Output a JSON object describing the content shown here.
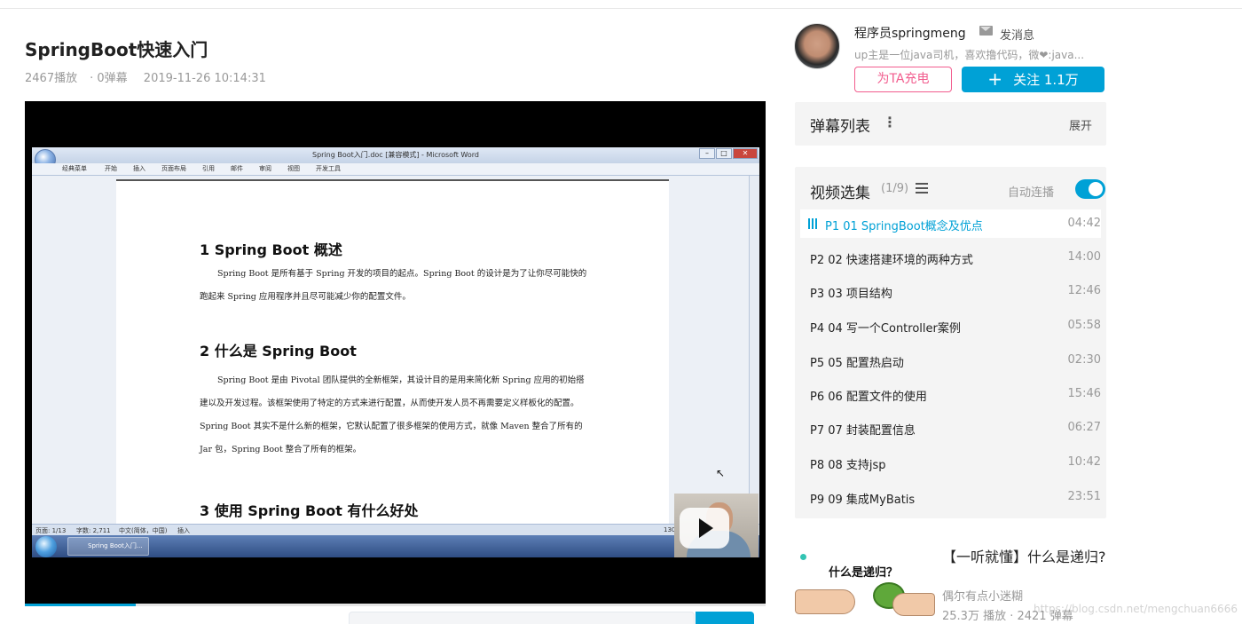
{
  "video": {
    "title": "SpringBoot快速入门",
    "plays": "2467播放",
    "danmaku_count": "0弹幕",
    "date": "2019-11-26 10:14:31",
    "progress_fraction": 0.15
  },
  "word": {
    "window_title": "Spring Boot入门.doc [兼容模式] - Microsoft Word",
    "ribbon_tabs": [
      "经典菜单",
      "开始",
      "插入",
      "页面布局",
      "引用",
      "邮件",
      "审阅",
      "视图",
      "开发工具"
    ],
    "headings": [
      "1 Spring Boot 概述",
      "2 什么是 Spring Boot",
      "3 使用 Spring Boot 有什么好处"
    ],
    "paragraphs": [
      "Spring Boot 是所有基于 Spring 开发的项目的起点。Spring Boot 的设计是为了让你尽可能快的跑起来 Spring 应用程序并且尽可能减少你的配置文件。",
      "Spring Boot 是由 Pivotal 团队提供的全新框架，其设计目的是用来简化新 Spring 应用的初始搭建以及开发过程。该框架使用了特定的方式来进行配置，从而使开发人员不再需要定义样板化的配置。Spring Boot 其实不是什么新的框架，它默认配置了很多框架的使用方式，就像 Maven 整合了所有的 Jar 包，Spring Boot 整合了所有的框架。"
    ],
    "status_page": "页面: 1/13",
    "status_words": "字数: 2,711",
    "status_lang": "中文(简体，中国)",
    "status_insert": "插入",
    "status_zoom": "130",
    "taskbar_item": "Spring Boot入门..."
  },
  "up": {
    "name": "程序员springmeng",
    "message_label": "发消息",
    "description": "up主是一位java司机，喜欢撸代码，微❤:java...",
    "charge_label": "为TA充电",
    "follow_label": "关注 1.1万"
  },
  "danmaku_panel": {
    "title": "弹幕列表",
    "expand_label": "展开"
  },
  "playlist": {
    "title": "视频选集",
    "count": "(1/9)",
    "auto_label": "自动连播",
    "auto_on": true,
    "items": [
      {
        "label": "P1   01 SpringBoot概念及优点",
        "duration": "04:42",
        "active": true
      },
      {
        "label": "P2   02 快速搭建环境的两种方式",
        "duration": "14:00"
      },
      {
        "label": "P3   03 项目结构",
        "duration": "12:46"
      },
      {
        "label": "P4   04 写一个Controller案例",
        "duration": "05:58"
      },
      {
        "label": "P5   05 配置热启动",
        "duration": "02:30"
      },
      {
        "label": "P6   06 配置文件的使用",
        "duration": "15:46"
      },
      {
        "label": "P7   07 封装配置信息",
        "duration": "06:27"
      },
      {
        "label": "P8   08 支持jsp",
        "duration": "10:42"
      },
      {
        "label": "P9   09 集成MyBatis",
        "duration": "23:51"
      }
    ]
  },
  "recommend": {
    "thumb_text": "什么是递归？",
    "title": "【一听就懂】什么是递归?",
    "author": "偶尔有点小迷糊",
    "stats": "25.3万 播放 · 2421 弹幕"
  },
  "watermark": "https://blog.csdn.net/mengchuan6666"
}
